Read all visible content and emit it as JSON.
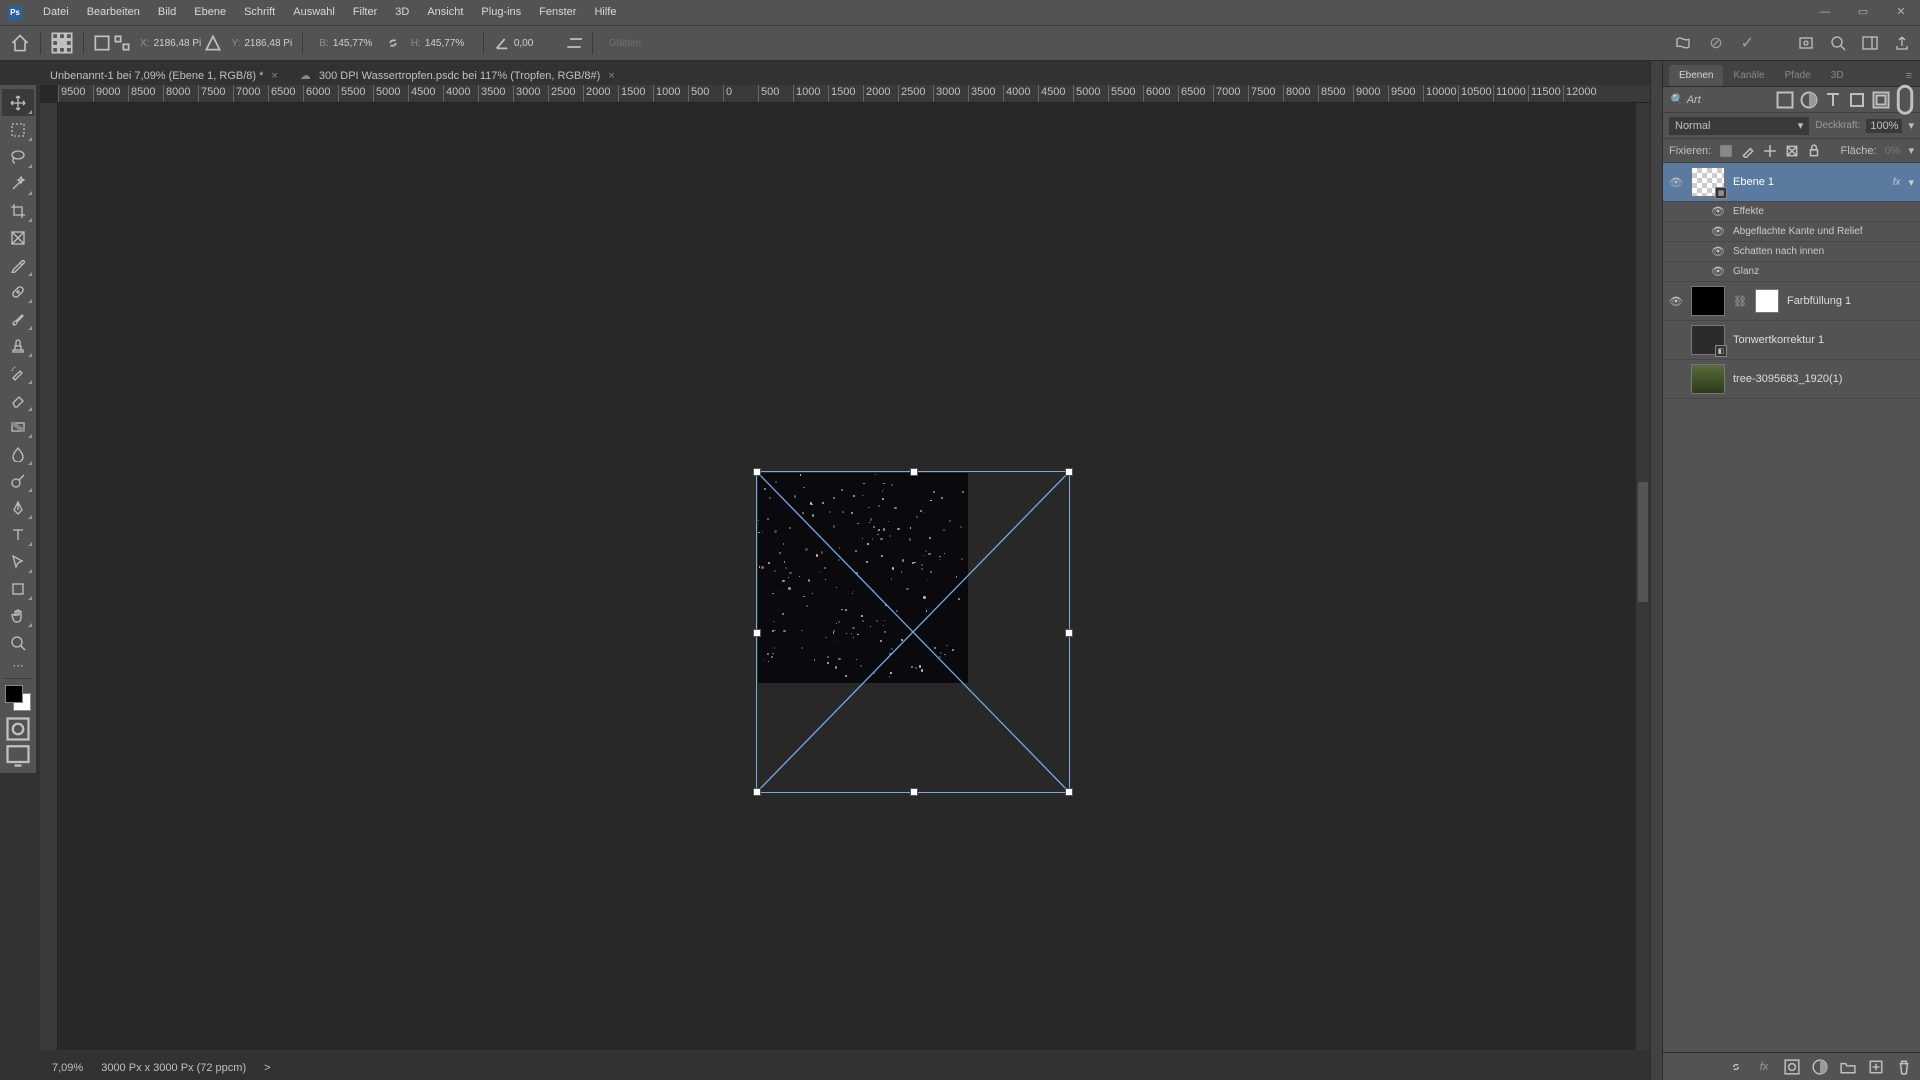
{
  "menu": [
    "Datei",
    "Bearbeiten",
    "Bild",
    "Ebene",
    "Schrift",
    "Auswahl",
    "Filter",
    "3D",
    "Ansicht",
    "Plug-ins",
    "Fenster",
    "Hilfe"
  ],
  "opt": {
    "x_lbl": "X:",
    "x": "2186,48 Pi",
    "y_lbl": "Y:",
    "y": "2186,48 Pi",
    "w_lbl": "B:",
    "w": "145,77%",
    "h_lbl": "H:",
    "h": "145,77%",
    "rot": "0,00",
    "interp": "Glätten"
  },
  "tabs": [
    {
      "title": "Unbenannt-1 bei 7,09% (Ebene 1, RGB/8) *"
    },
    {
      "title": "300 DPI Wassertropfen.psdc bei 117% (Tropfen, RGB/8#)",
      "cloud": true
    }
  ],
  "ruler": [
    "-9500",
    "-9000",
    "-8500",
    "-8000",
    "-7500",
    "-7000",
    "-6500",
    "-6000",
    "-5500",
    "-5000",
    "-4500",
    "-4000",
    "-3500",
    "-3000",
    "-2500",
    "-2000",
    "-1500",
    "-1000",
    "-500",
    "0",
    "500",
    "1000",
    "1500",
    "2000",
    "2500",
    "3000",
    "3500",
    "4000",
    "4500",
    "5000",
    "5500",
    "6000",
    "6500",
    "7000",
    "7500",
    "8000",
    "8500",
    "9000",
    "9500",
    "10000",
    "10500",
    "11000",
    "11500",
    "12000"
  ],
  "status": {
    "zoom": "7,09%",
    "dims": "3000 Px x 3000 Px (72 ppcm)",
    "chev": ">"
  },
  "panel": {
    "tabs": [
      "Ebenen",
      "Kanäle",
      "Pfade",
      "3D"
    ],
    "search_ph": "Art",
    "blend": "Normal",
    "opacity_lbl": "Deckkraft:",
    "opacity": "100%",
    "lock_lbl": "Fixieren:",
    "fill_lbl": "Fläche:",
    "fill": "0%",
    "layer1": "Ebene 1",
    "fx": "fx",
    "eff_title": "Effekte",
    "effects": [
      "Abgeflachte Kante und Relief",
      "Schatten nach innen",
      "Glanz"
    ],
    "fill_layer": "Farbfüllung 1",
    "levels": "Tonwertkorrektur 1",
    "img_layer": "tree-3095683_1920(1)"
  }
}
